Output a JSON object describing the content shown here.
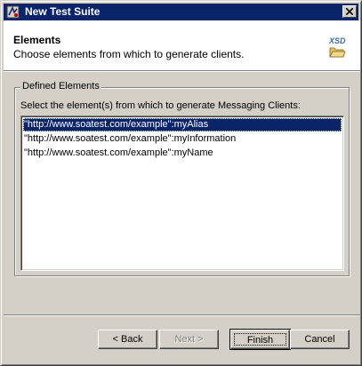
{
  "window": {
    "title": "New Test Suite",
    "title_bar_color": "#0a246a"
  },
  "header": {
    "title": "Elements",
    "description": "Choose elements from which to generate clients.",
    "icon": "xsd-folder-icon",
    "icon_label": "XSD"
  },
  "group": {
    "legend": "Defined Elements",
    "instruction": "Select the element(s) from which to generate Messaging Clients:"
  },
  "elements": [
    {
      "label": "\"http://www.soatest.com/example\":myAlias",
      "selected": true
    },
    {
      "label": "\"http://www.soatest.com/example\":myInformation",
      "selected": false
    },
    {
      "label": "\"http://www.soatest.com/example\":myName",
      "selected": false
    }
  ],
  "buttons": {
    "back": "< Back",
    "next": "Next >",
    "finish": "Finish",
    "cancel": "Cancel"
  }
}
